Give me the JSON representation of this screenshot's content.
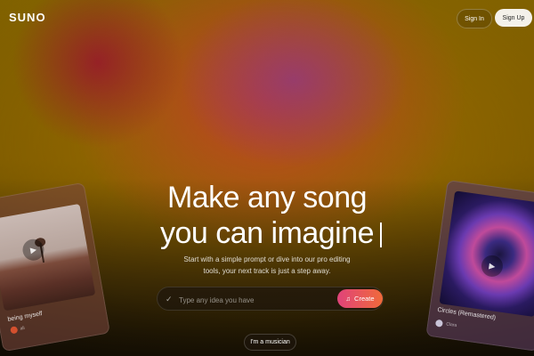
{
  "header": {
    "logo": "SUNO",
    "sign_in_label": "Sign In",
    "sign_up_label": "Sign Up"
  },
  "hero": {
    "headline_line1": "Make any song",
    "headline_line2": "you can imagine",
    "subtext": "Start with a simple prompt or dive into our pro editing tools, your next track is just a step away."
  },
  "prompt": {
    "placeholder": "Type any idea you have",
    "create_label": "Create",
    "create_icon": "music-note-icon",
    "input_icon": "sparkle-check-icon"
  },
  "musician_button_label": "I'm a musician",
  "cards": [
    {
      "title": "being myself",
      "artist": "ali"
    },
    {
      "title": "Circles (Remastered)",
      "artist": "Clara"
    }
  ],
  "colors": {
    "create_gradient_start": "#e0437a",
    "create_gradient_end": "#f06a3a",
    "sign_up_bg": "#f4f1ea"
  }
}
